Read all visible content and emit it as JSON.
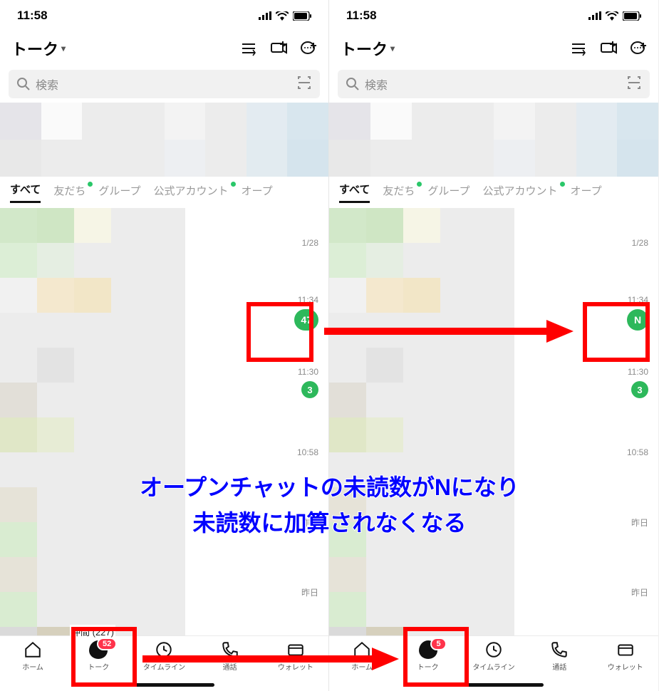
{
  "status": {
    "time": "11:58"
  },
  "header": {
    "title": "トーク",
    "title_caret": "▾"
  },
  "search": {
    "placeholder": "検索"
  },
  "tabs": {
    "all": "すべて",
    "friends": "友だち",
    "groups": "グループ",
    "official": "公式アカウント",
    "open": "オープ"
  },
  "chats": [
    {
      "time": "1/28",
      "badge": null
    },
    {
      "time": "11:34",
      "badge_left": "47",
      "badge_right": "N"
    },
    {
      "time": "11:30",
      "badge": "3"
    },
    {
      "time": "10:58",
      "badge": null
    },
    {
      "time": "昨日",
      "badge": null
    },
    {
      "time": "昨日",
      "badge": null
    }
  ],
  "nav": {
    "home": "ホーム",
    "talk": "トーク",
    "timeline": "タイムライン",
    "call": "通話",
    "wallet": "ウォレット",
    "talk_badge_left": "52",
    "talk_badge_right": "5",
    "cutlabel_left": "仲間 (227)"
  },
  "annotation": {
    "line1": "オープンチャットの未読数がNになり",
    "line2": "未読数に加算されなくなる"
  }
}
